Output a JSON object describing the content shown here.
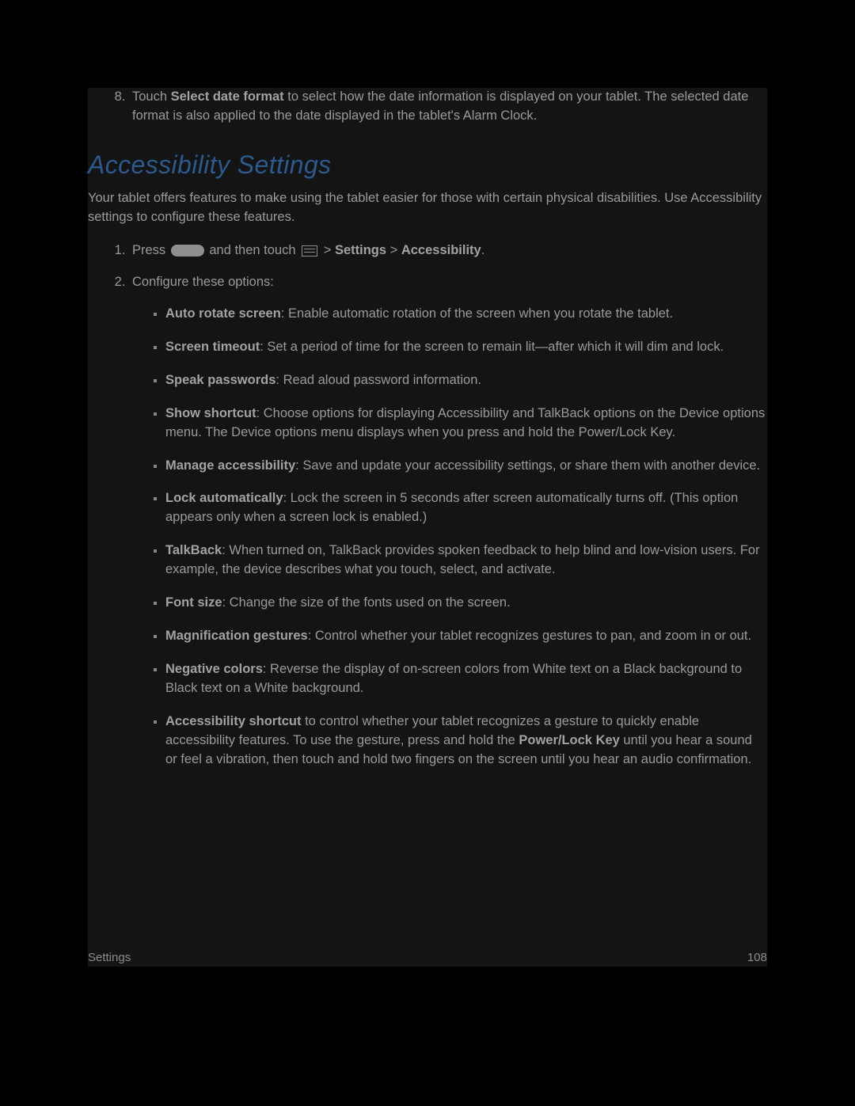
{
  "item8": {
    "pre": "Touch ",
    "bold": "Select date format",
    "post": " to select how the date information is displayed on your tablet. The selected date format is also applied to the date displayed in the tablet's Alarm Clock."
  },
  "heading": "Accessibility Settings",
  "intro": "Your tablet offers features to make using the tablet easier for those with certain physical disabilities. Use Accessibility settings to configure these features.",
  "step1": {
    "a": "Press ",
    "b": " and then touch ",
    "c": " > ",
    "settings": "Settings",
    "sep": " > ",
    "accessibility": "Accessibility",
    "end": "."
  },
  "step2_intro": "Configure these options:",
  "opts": [
    {
      "b": "Auto rotate screen",
      "t": ": Enable automatic rotation of the screen when you rotate the tablet."
    },
    {
      "b": "Screen timeout",
      "t": ": Set a period of time for the screen to remain lit—after which it will dim and lock."
    },
    {
      "b": "Speak passwords",
      "t": ": Read aloud password information."
    },
    {
      "b": "Show shortcut",
      "t": ": Choose options for displaying Accessibility and TalkBack options on the Device options menu. The Device options menu displays when you press and hold the Power/Lock Key."
    },
    {
      "b": "Manage accessibility",
      "t": ": Save and update your accessibility settings, or share them with another device."
    },
    {
      "b": "Lock automatically",
      "t": ": Lock the screen in 5 seconds after screen automatically turns off. (This option appears only when a screen lock is enabled.)"
    },
    {
      "b": "TalkBack",
      "t": ": When turned on, TalkBack provides spoken feedback to help blind and low-vision users. For example, the device describes what you touch, select, and activate."
    },
    {
      "b": "Font size",
      "t": ": Change the size of the fonts used on the screen."
    },
    {
      "b": "Magnification gestures",
      "t": ": Control whether your tablet recognizes gestures to pan, and zoom in or out."
    },
    {
      "b": "Negative colors",
      "t": ": Reverse the display of on-screen colors from White text on a Black background to Black text on a White background."
    }
  ],
  "opt_last": {
    "b1": "Accessibility shortcut",
    "t1": " to control whether your tablet recognizes a gesture to quickly enable accessibility features. To use the gesture, press and hold the ",
    "b2": "Power/Lock Key",
    "t2": " until you hear a sound or feel a vibration, then touch and hold two fingers on the screen until you hear an audio confirmation."
  },
  "footer": {
    "left": "Settings",
    "right": "108"
  }
}
